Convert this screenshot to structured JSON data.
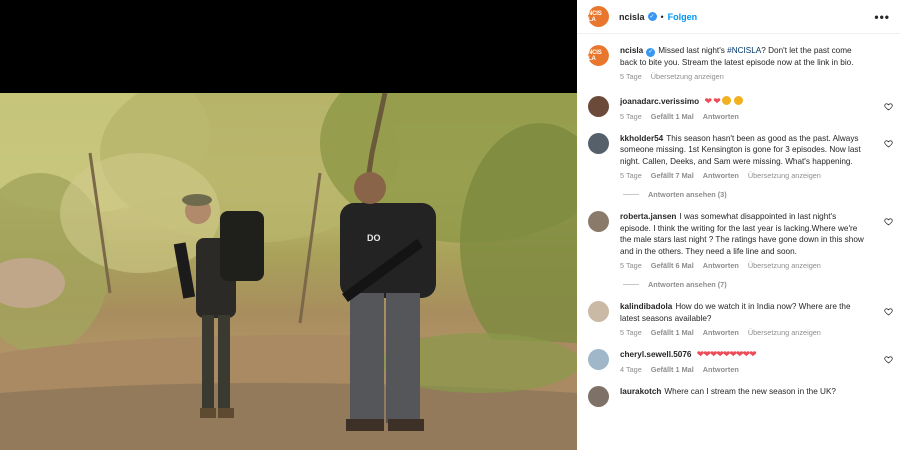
{
  "header": {
    "avatar_text": "NCIS LA",
    "username": "ncisla",
    "separator": "•",
    "follow_label": "Folgen",
    "more_label": "•••"
  },
  "caption": {
    "username": "ncisla",
    "text_before": "Missed last night's ",
    "hashtag": "#NCISLA",
    "text_after": "? Don't let the past come back to bite you. Stream the latest episode now at the link in bio.",
    "time": "5 Tage",
    "translate": "Übersetzung anzeigen"
  },
  "comments": [
    {
      "username": "joanadarc.verissimo",
      "text": "",
      "emoji": [
        "red-heart",
        "red-heart",
        "heart-eyes-face",
        "heart-eyes-face"
      ],
      "time": "5 Tage",
      "likes": "Gefällt 1 Mal",
      "reply": "Antworten"
    },
    {
      "username": "kkholder54",
      "text": "This season hasn't been as good as the past. Always someone missing. 1st Kensington is gone for 3 episodes. Now last night. Callen, Deeks, and Sam were missing. What's happening.",
      "time": "5 Tage",
      "likes": "Gefällt 7 Mal",
      "reply": "Antworten",
      "translate": "Übersetzung anzeigen",
      "view_replies": "Antworten ansehen (3)"
    },
    {
      "username": "roberta.jansen",
      "text": "I was somewhat disappointed in last night's episode. I think the writing for the last year is lacking.Where we're the male stars last night ? The ratings have gone down in this show and in the others. They need a life line and soon.",
      "time": "5 Tage",
      "likes": "Gefällt 6 Mal",
      "reply": "Antworten",
      "translate": "Übersetzung anzeigen",
      "view_replies": "Antworten ansehen (7)"
    },
    {
      "username": "kalindibadola",
      "text": "How do we watch it in India now? Where are the latest seasons available?",
      "time": "5 Tage",
      "likes": "Gefällt 1 Mal",
      "reply": "Antworten",
      "translate": "Übersetzung anzeigen"
    },
    {
      "username": "cheryl.sewell.5076",
      "text": "",
      "heart_count": 9,
      "time": "4 Tage",
      "likes": "Gefällt 1 Mal",
      "reply": "Antworten"
    },
    {
      "username": "laurakotch",
      "text": "Where can I stream the new season in the UK?"
    }
  ],
  "colors": {
    "accent_blue": "#0095f6",
    "brand_orange": "#e8762d",
    "heart_red": "#ed4956",
    "muted_text": "#8e8e8e"
  }
}
